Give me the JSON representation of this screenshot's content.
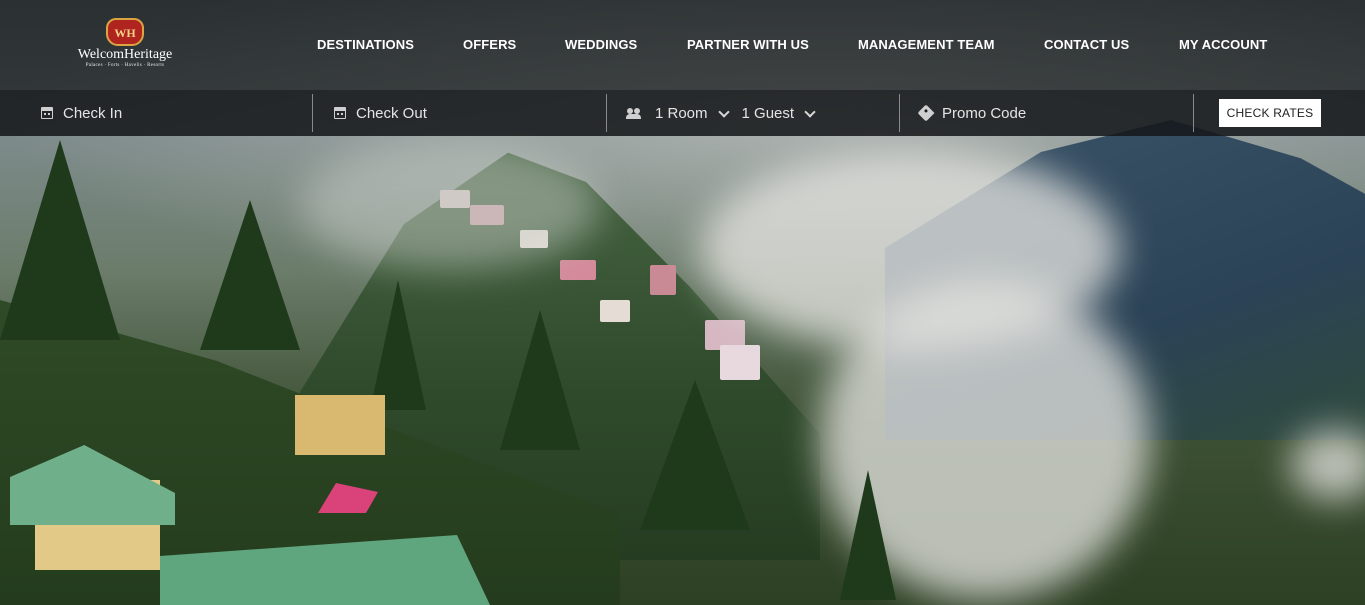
{
  "brand": {
    "crest_text": "WH",
    "name": "WelcomHeritage",
    "tagline": "Palaces · Forts · Havelis · Resorts"
  },
  "nav": {
    "items": [
      {
        "label": "DESTINATIONS"
      },
      {
        "label": "OFFERS"
      },
      {
        "label": "WEDDINGS"
      },
      {
        "label": "PARTNER WITH US"
      },
      {
        "label": "MANAGEMENT TEAM"
      },
      {
        "label": "CONTACT US"
      },
      {
        "label": "MY ACCOUNT"
      }
    ]
  },
  "booking": {
    "check_in": "Check In",
    "check_out": "Check Out",
    "rooms": "1 Room",
    "guests": "1 Guest",
    "promo_placeholder": "Promo Code",
    "check_rates": "CHECK RATES",
    "icons": [
      "calendar-icon",
      "calendar-icon",
      "people-icon",
      "tag-icon"
    ]
  },
  "colors": {
    "header_bg": "#181a1c",
    "button_bg": "#ffffff",
    "crest_red": "#b0241f",
    "crest_gold": "#d9a441"
  }
}
